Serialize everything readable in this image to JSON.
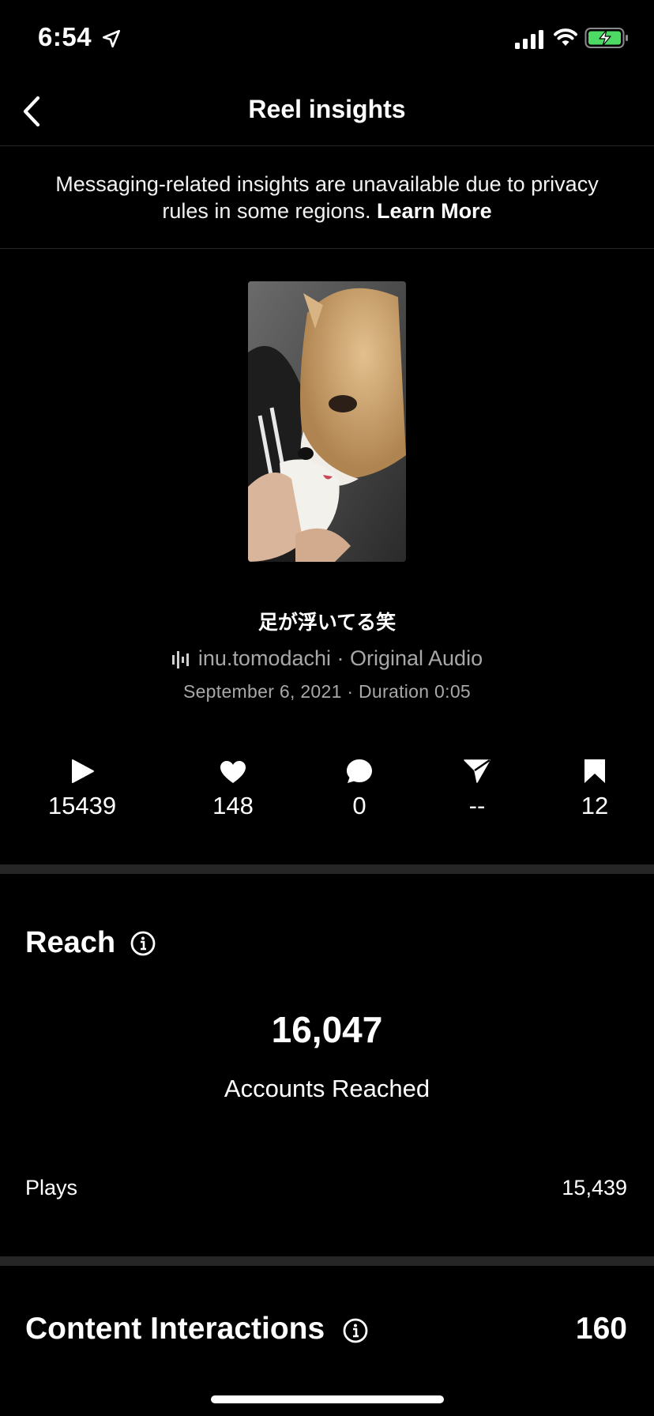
{
  "status_bar": {
    "time": "6:54"
  },
  "nav": {
    "title": "Reel insights"
  },
  "notice": {
    "text": "Messaging-related insights are unavailable due to privacy rules in some regions.",
    "link": "Learn More"
  },
  "reel": {
    "caption": "足が浮いてる笑",
    "audio": "inu.tomodachi · Original Audio",
    "date_duration": "September 6, 2021 · Duration 0:05"
  },
  "stats": [
    {
      "icon": "play-icon",
      "value": "15439"
    },
    {
      "icon": "heart-icon",
      "value": "148"
    },
    {
      "icon": "comment-icon",
      "value": "0"
    },
    {
      "icon": "share-icon",
      "value": "--"
    },
    {
      "icon": "bookmark-icon",
      "value": "12"
    }
  ],
  "reach": {
    "title": "Reach",
    "accounts_reached": "16,047",
    "accounts_reached_label": "Accounts Reached",
    "plays_label": "Plays",
    "plays_value": "15,439"
  },
  "content_interactions": {
    "title": "Content Interactions",
    "value": "160"
  },
  "colors": {
    "background": "#000000",
    "secondary_text": "#a8a8a8",
    "divider": "#262626",
    "battery_green": "#4cd964"
  }
}
